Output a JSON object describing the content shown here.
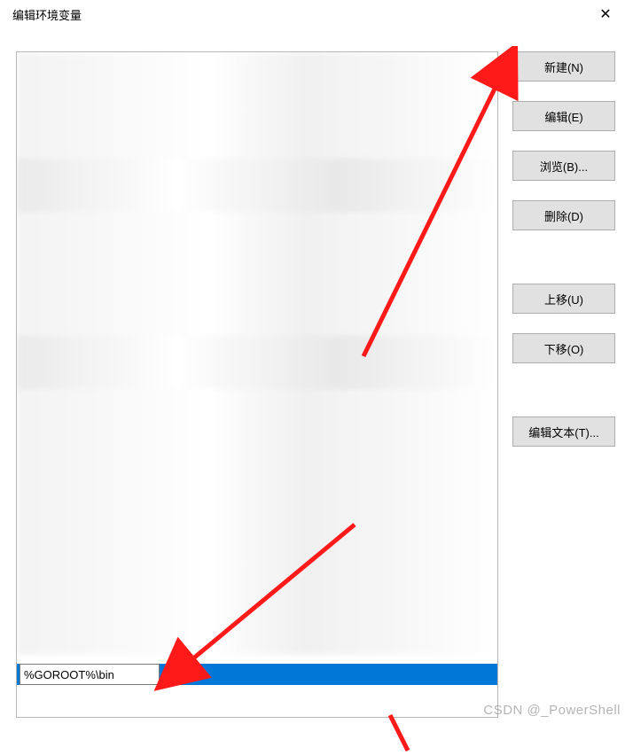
{
  "title": "编辑环境变量",
  "close_symbol": "✕",
  "buttons": {
    "new": "新建(N)",
    "edit": "编辑(E)",
    "browse": "浏览(B)...",
    "delete": "删除(D)",
    "move_up": "上移(U)",
    "move_down": "下移(O)",
    "edit_text": "编辑文本(T)..."
  },
  "input_value": "%GOROOT%\\bin",
  "watermark": "CSDN @_PowerShell"
}
